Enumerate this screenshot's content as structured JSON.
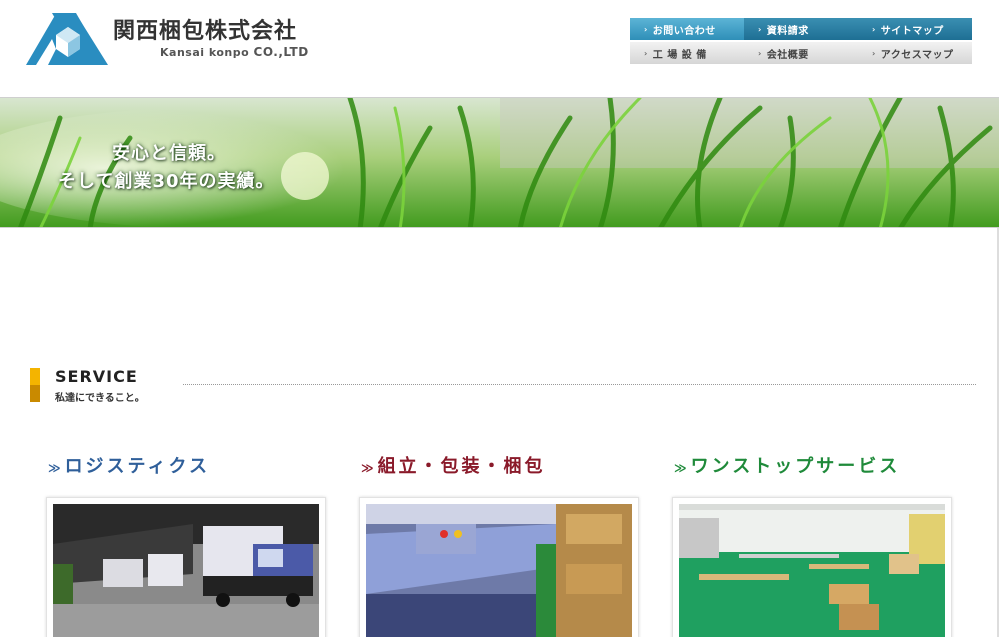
{
  "header": {
    "company_name": "関西梱包株式会社",
    "company_en_prefix": "Kansai konpo ",
    "company_en_suffix": "CO.,LTD",
    "logo_icon": "kansai-konpo-logo-icon"
  },
  "nav": {
    "top": [
      {
        "label": "お問い合わせ"
      },
      {
        "label": "資料請求"
      },
      {
        "label": "サイトマップ"
      }
    ],
    "bottom": [
      {
        "label": "工 場 設 備"
      },
      {
        "label": "会社概要"
      },
      {
        "label": "アクセスマップ"
      }
    ]
  },
  "hero": {
    "line1": "安心と信頼。",
    "line2": "そして創業30年の実績。"
  },
  "service": {
    "title": "SERVICE",
    "subtitle": "私達にできること。",
    "columns": [
      {
        "title": "ロジスティクス",
        "color": "#2f5f9a",
        "photo": "truck-depot-photo"
      },
      {
        "title": "組立・包装・梱包",
        "color": "#8a1a2a",
        "photo": "packing-machine-photo"
      },
      {
        "title": "ワンストップサービス",
        "color": "#1f8a3a",
        "photo": "warehouse-floor-photo"
      }
    ]
  },
  "colors": {
    "nav_blue": "#1e6f94",
    "nav_gray": "#d6d6d6",
    "accent_orange": "#f4b400"
  }
}
